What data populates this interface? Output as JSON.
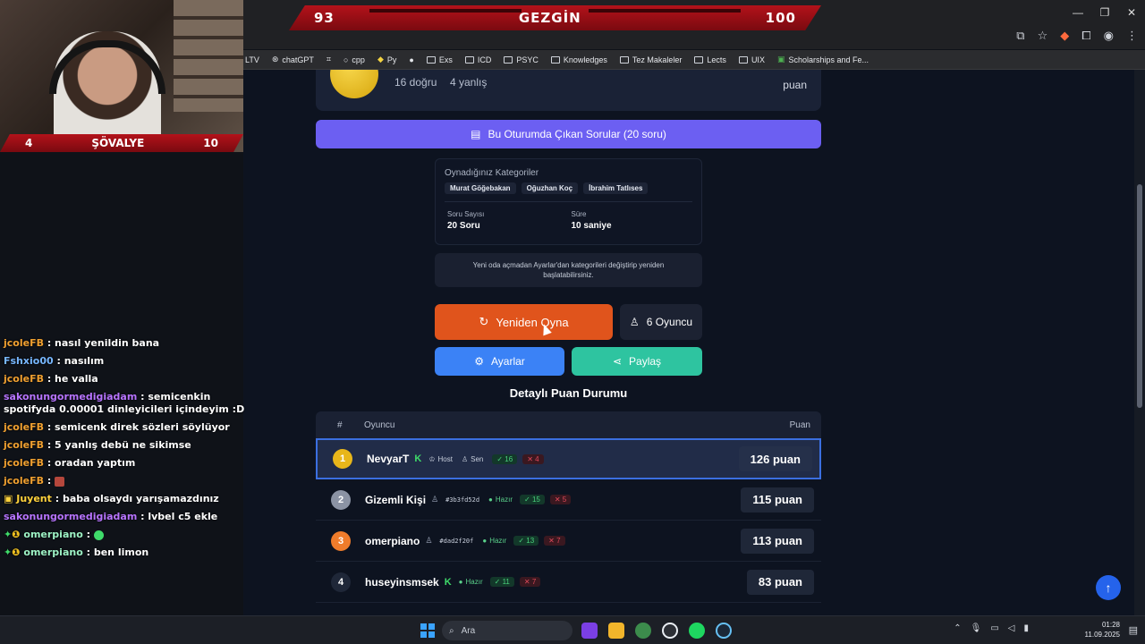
{
  "stream": {
    "top_banner": {
      "left": "93",
      "center": "GEZGİN",
      "right": "100"
    },
    "cam_banner": {
      "left": "4",
      "center": "ŞÖVALYE",
      "right": "10"
    }
  },
  "browser": {
    "bookmarks": [
      "LTV",
      "chatGPT",
      "cpp",
      "Py",
      "Exs",
      "ICD",
      "PSYC",
      "Knowledges",
      "Tez Makaleler",
      "Lects",
      "UIX",
      "Scholarships and Fe..."
    ]
  },
  "chat": [
    {
      "user": "jcoleFB",
      "text": ": nasıl yenildin bana",
      "color": "u-o"
    },
    {
      "user": "Fshxio00",
      "text": ": nasılım",
      "color": "u-b"
    },
    {
      "user": "jcoleFB",
      "text": ": he valla",
      "color": "u-o"
    },
    {
      "user": "sakonungormedigiadam",
      "text": ": semicenkin spotifyda 0.00001 dinleyicileri içindeyim :D",
      "color": "u-p"
    },
    {
      "user": "jcoleFB",
      "text": ": semicenk direk sözleri söylüyor",
      "color": "u-o"
    },
    {
      "user": "jcoleFB",
      "text": ": 5 yanlış debü ne sikimse",
      "color": "u-o"
    },
    {
      "user": "jcoleFB",
      "text": ": oradan yaptım",
      "color": "u-o"
    },
    {
      "user": "jcoleFB",
      "text": ":",
      "color": "u-o"
    },
    {
      "user": "Juyent",
      "text": ": baba olsaydı yarışamazdınız",
      "color": "u-y"
    },
    {
      "user": "sakonungormedigiadam",
      "text": ": lvbel c5 ekle",
      "color": "u-p"
    },
    {
      "user": "omerpiano",
      "text": ":",
      "color": "u-g"
    },
    {
      "user": "omerpiano",
      "text": ": ben limon",
      "color": "u-g"
    }
  ],
  "result": {
    "correct": "16 doğru",
    "wrong": "4 yanlış",
    "points_label": "puan"
  },
  "questions_button": "Bu Oturumda Çıkan Sorular (20 soru)",
  "info": {
    "title": "Oynadığınız Kategoriler",
    "tags": [
      "Murat Göğebakan",
      "Oğuzhan Koç",
      "İbrahim Tatlıses"
    ],
    "count_label": "Soru Sayısı",
    "count_value": "20 Soru",
    "time_label": "Süre",
    "time_value": "10 saniye"
  },
  "note": "Yeni oda açmadan Ayarlar'dan kategorileri değiştirip yeniden başlatabilirsiniz.",
  "buttons": {
    "replay": "Yeniden Oyna",
    "players": "6 Oyuncu",
    "settings": "Ayarlar",
    "share": "Paylaş"
  },
  "scoreboard": {
    "title": "Detaylı Puan Durumu",
    "col_num": "#",
    "col_player": "Oyuncu",
    "col_points": "Puan",
    "rows": [
      {
        "rank": "1",
        "name": "NevyarT",
        "host": "Host",
        "you": "Sen",
        "correct": "16",
        "wrong": "4",
        "points": "126 puan"
      },
      {
        "rank": "2",
        "name": "Gizemli Kişi",
        "hash": "#3b3fd52d",
        "status": "Hazır",
        "correct": "15",
        "wrong": "5",
        "points": "115 puan"
      },
      {
        "rank": "3",
        "name": "omerpiano",
        "hash": "#dad2f20f",
        "status": "Hazır",
        "correct": "13",
        "wrong": "7",
        "points": "113 puan"
      },
      {
        "rank": "4",
        "name": "huseyinsmsek",
        "status": "Hazır",
        "correct": "11",
        "wrong": "7",
        "points": "83 puan"
      }
    ]
  },
  "taskbar": {
    "search": "Ara",
    "time": "01:28",
    "date": "11.09.2025"
  }
}
